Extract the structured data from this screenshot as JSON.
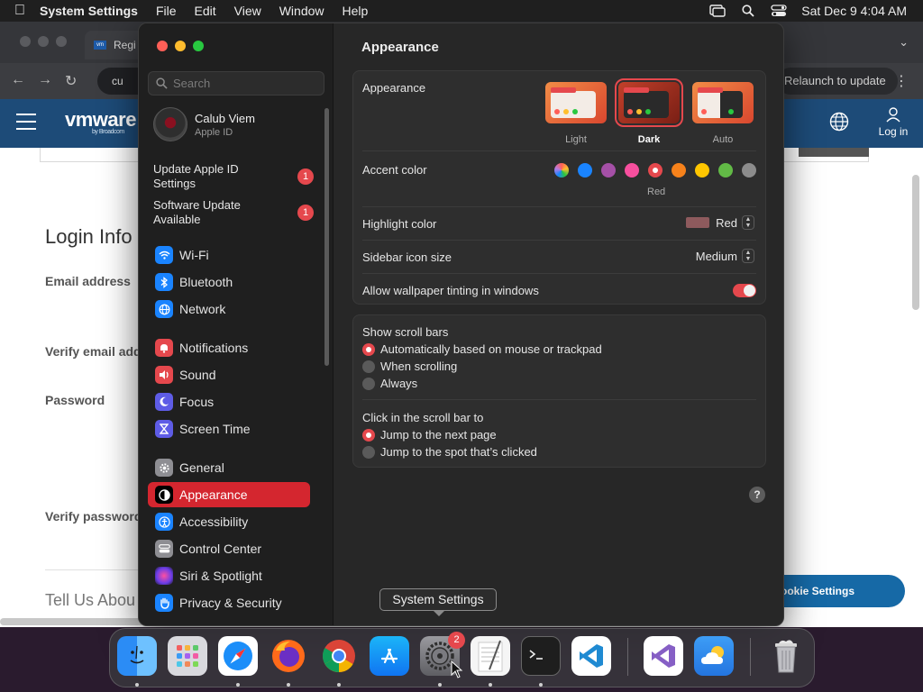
{
  "menubar": {
    "app_name": "System Settings",
    "menus": [
      "File",
      "Edit",
      "View",
      "Window",
      "Help"
    ],
    "clock": "Sat Dec 9  4:04 AM"
  },
  "browser": {
    "tab_title": "Regi",
    "address": "cu",
    "relaunch_label": "Relaunch to update",
    "vmware": {
      "logo": "vmware",
      "logo_sub": "by Broadcom",
      "login_label": "Log in",
      "heading": "Login Info",
      "labels": [
        "Email address",
        "Verify email add",
        "Password",
        "Verify password"
      ],
      "heading2": "Tell Us Abou",
      "cookie_button": "ookie Settings"
    }
  },
  "settings": {
    "search_placeholder": "Search",
    "profile": {
      "name": "Calub Viem",
      "subtitle": "Apple ID"
    },
    "notices": [
      {
        "label": "Update Apple ID Settings",
        "count": "1"
      },
      {
        "label": "Software Update Available",
        "count": "1"
      }
    ],
    "nav": [
      {
        "label": "Wi-Fi",
        "icon": "wifi-icon",
        "color": "#1a84ff"
      },
      {
        "label": "Bluetooth",
        "icon": "bluetooth-icon",
        "color": "#1a84ff"
      },
      {
        "label": "Network",
        "icon": "globe-icon",
        "color": "#1a84ff"
      },
      {
        "label": "Notifications",
        "icon": "bell-icon",
        "color": "#e5484d"
      },
      {
        "label": "Sound",
        "icon": "speaker-icon",
        "color": "#e5484d"
      },
      {
        "label": "Focus",
        "icon": "moon-icon",
        "color": "#5e5ce6"
      },
      {
        "label": "Screen Time",
        "icon": "hourglass-icon",
        "color": "#5e5ce6"
      },
      {
        "label": "General",
        "icon": "gear-icon",
        "color": "#8e8e93"
      },
      {
        "label": "Appearance",
        "icon": "appearance-icon",
        "color": "#000000",
        "active": true
      },
      {
        "label": "Accessibility",
        "icon": "accessibility-icon",
        "color": "#1a84ff"
      },
      {
        "label": "Control Center",
        "icon": "control-center-icon",
        "color": "#8e8e93"
      },
      {
        "label": "Siri & Spotlight",
        "icon": "siri-icon",
        "color": "#b44bd6"
      },
      {
        "label": "Privacy & Security",
        "icon": "hand-icon",
        "color": "#1a84ff"
      }
    ],
    "page_title": "Appearance",
    "appearance": {
      "label": "Appearance",
      "options": [
        "Light",
        "Dark",
        "Auto"
      ],
      "selected": "Dark"
    },
    "accent": {
      "label": "Accent color",
      "colors": [
        "#b77be0",
        "#1a84ff",
        "#a550a7",
        "#f74f9e",
        "#e5484d",
        "#f7821b",
        "#ffc600",
        "#62ba46",
        "#8c8c8c"
      ],
      "selected_name": "Red"
    },
    "highlight": {
      "label": "Highlight color",
      "value": "Red",
      "swatch": "#8e5a5d"
    },
    "icon_size": {
      "label": "Sidebar icon size",
      "value": "Medium"
    },
    "tinting": {
      "label": "Allow wallpaper tinting in windows",
      "on": true
    },
    "scrollbars": {
      "label": "Show scroll bars",
      "options": [
        "Automatically based on mouse or trackpad",
        "When scrolling",
        "Always"
      ]
    },
    "click_scroll": {
      "label": "Click in the scroll bar to",
      "options": [
        "Jump to the next page",
        "Jump to the spot that’s clicked"
      ]
    },
    "help": "?"
  },
  "tooltip": "System Settings",
  "dock": {
    "settings_badge": "2"
  }
}
